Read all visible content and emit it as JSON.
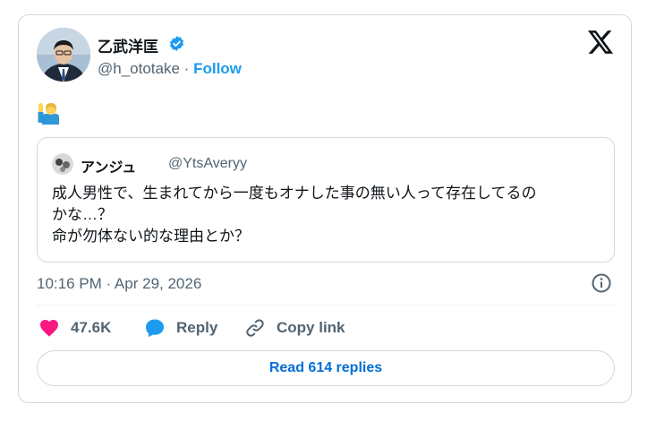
{
  "author": {
    "name": "乙武洋匡",
    "handle": "@h_ototake",
    "separator": "·",
    "follow_label": "Follow"
  },
  "icons": {
    "brand": "x-logo-icon",
    "verified": "verified-badge-icon",
    "emoji": "person-raising-hand-emoji",
    "info": "info-icon",
    "like": "heart-icon",
    "reply": "speech-bubble-icon",
    "copy": "link-icon"
  },
  "quoted_tweet": {
    "name": "アンジュ",
    "handle": "@YtsAveryy",
    "text_lines": [
      "成人男性で、生まれてから一度もオナした事の無い人って存在してるの",
      "かな…？",
      "命が勿体ない的な理由とか？"
    ]
  },
  "timestamp": "10:16 PM · Apr 29, 2026",
  "actions": {
    "like_count": "47.6K",
    "reply_label": "Reply",
    "copy_label": "Copy link"
  },
  "read_replies_label": "Read 614 replies",
  "colors": {
    "link": "#1d9bf0",
    "heart": "#f91880",
    "reply_bubble": "#1d9bf0",
    "verified": "#1d9bf0",
    "secondary_text": "#536471",
    "border": "#cfd9de"
  }
}
